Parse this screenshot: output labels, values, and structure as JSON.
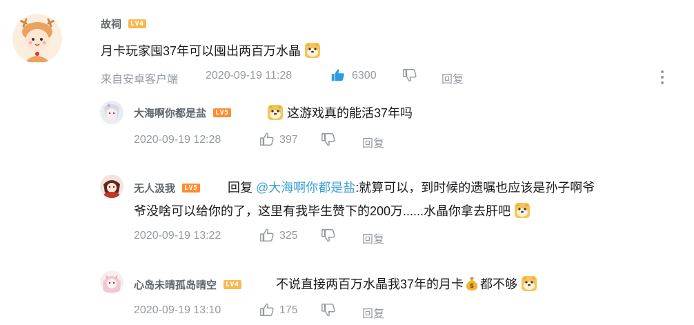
{
  "main_comment": {
    "username": "故祠",
    "level": "LV4",
    "text": "月卡玩家囤37年可以囤出两百万水晶",
    "source": "来自安卓客户端",
    "time": "2020-09-19 11:28",
    "likes": "6300",
    "reply_label": "回复"
  },
  "replies": [
    {
      "username": "大海啊你都是盐",
      "level": "LV5",
      "text": "这游戏真的能活37年吗",
      "time": "2020-09-19 12:28",
      "likes": "397",
      "reply_label": "回复"
    },
    {
      "username": "无人汲我",
      "level": "LV5",
      "reply_prefix": "回复",
      "mention": "@大海啊你都是盐",
      "text_line1": ":就算可以，到时候的遗嘱也应该是孙子啊爷",
      "text_line2": "爷没啥可以给你的了，这里有我毕生赞下的200万......水晶你拿去肝吧",
      "time": "2020-09-19 13:22",
      "likes": "325",
      "reply_label": "回复"
    },
    {
      "username": "心岛未晴孤岛晴空",
      "level": "LV4",
      "text_a": "不说直接两百万水晶我37年的月卡",
      "text_b": "都不够",
      "time": "2020-09-19 13:10",
      "likes": "175",
      "reply_label": "回复"
    }
  ],
  "colors": {
    "like_active": "#2a9de0",
    "lv4": "#f7b94d",
    "lv5": "#ff8c2e",
    "meta": "#9499a0",
    "mention": "#3a9fd6"
  },
  "icons": [
    "thumb-up-icon",
    "thumb-down-icon",
    "more-icon",
    "doge-emoji-icon",
    "money-bag-emoji-icon"
  ]
}
